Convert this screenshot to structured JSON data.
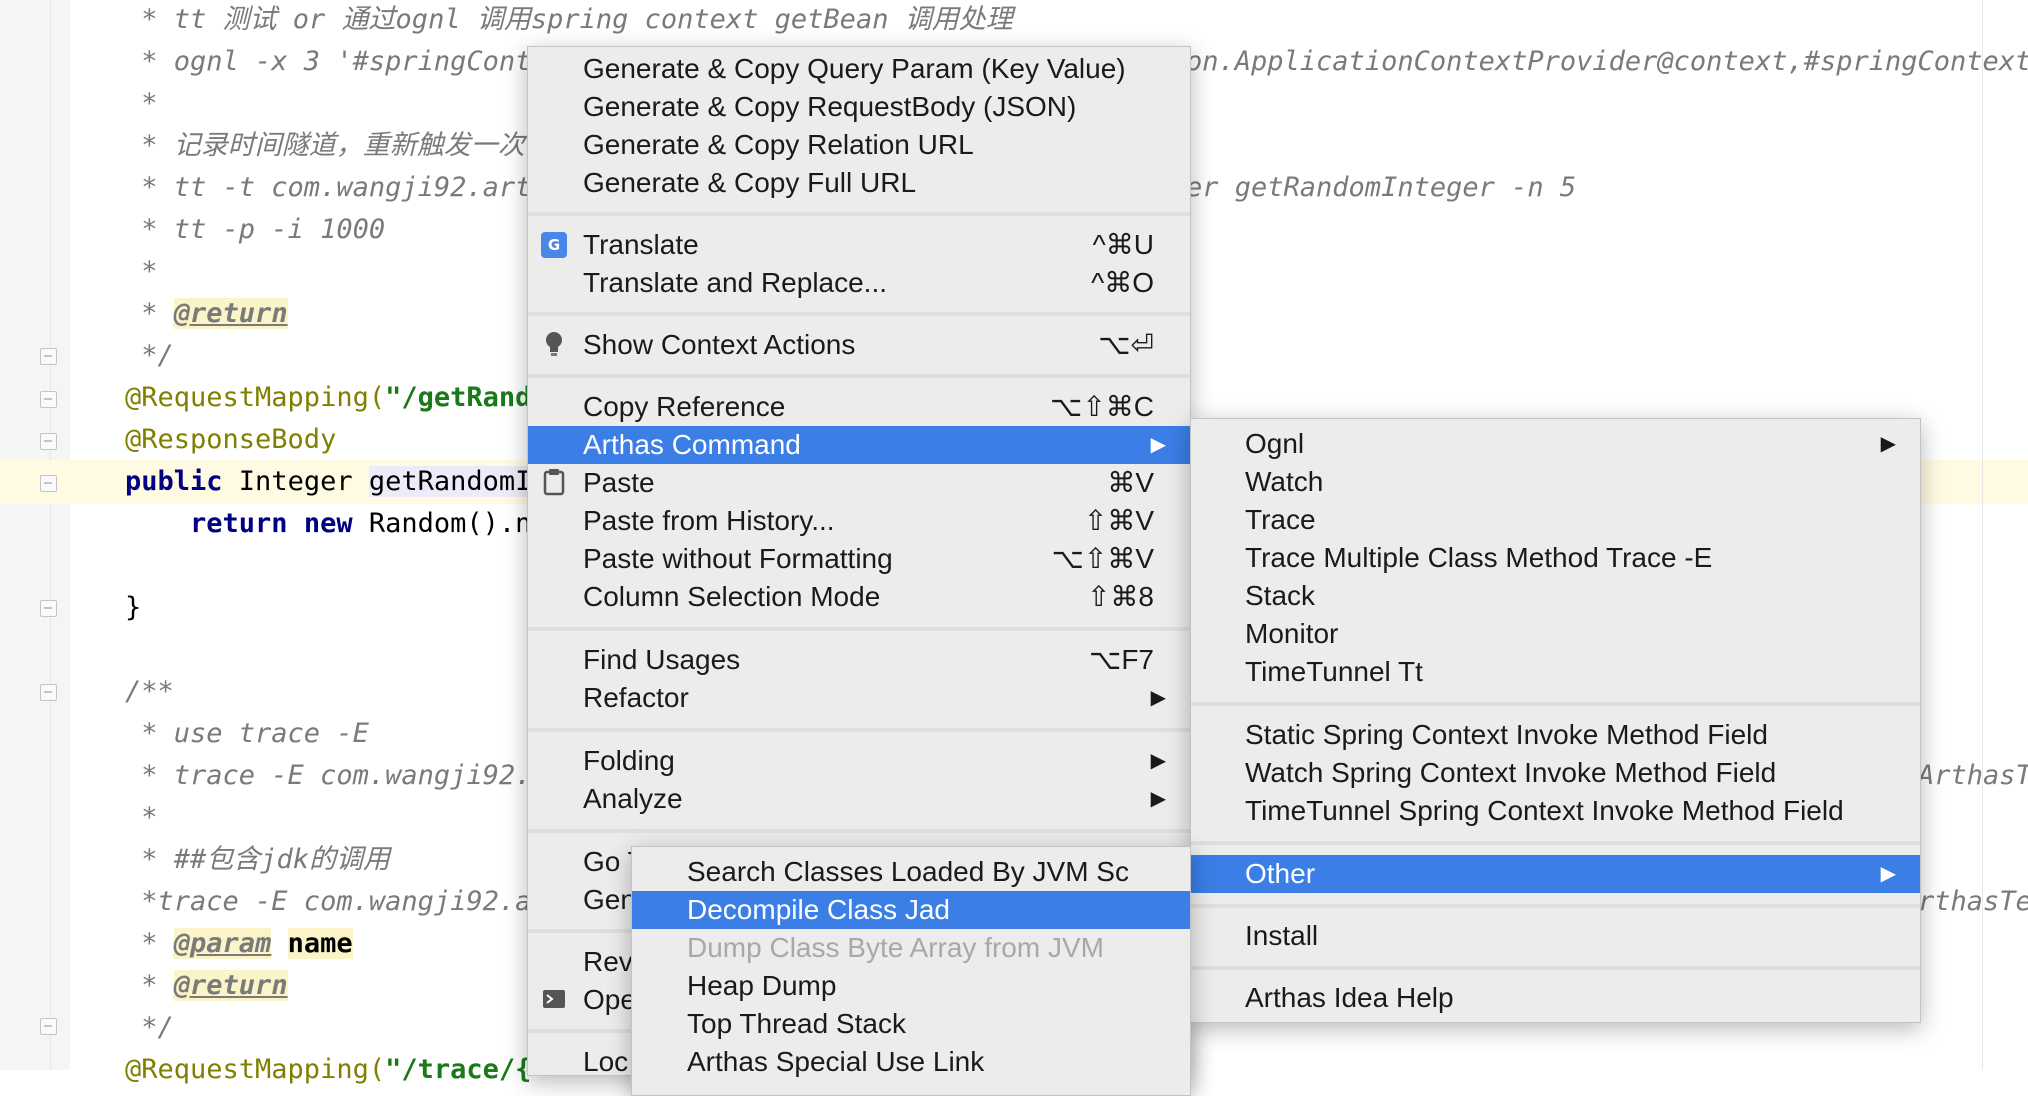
{
  "editor": {
    "code_lines": [
      {
        "t": " * tt 测试 or 通过ognl 调用spring context getBean 调用处理"
      },
      {
        "t": " * ognl -x 3 '#springCont"
      },
      {
        "t": " *"
      },
      {
        "t": " * 记录时间隧道，重新触发一次"
      },
      {
        "t": " * tt -t com.wangji92.art"
      },
      {
        "t": " * tt -p -i 1000"
      },
      {
        "t": " *"
      },
      {
        "t": " * "
      },
      {
        "t": " */"
      },
      {
        "t": "@RequestMapping("
      },
      {
        "t": "@ResponseBody"
      },
      {
        "t": "public"
      },
      {
        "t": "return"
      },
      {
        "t": "}"
      },
      {
        "t": "/**"
      },
      {
        "t": " * use trace -E"
      },
      {
        "t": " * trace -E com.wangji92."
      },
      {
        "t": " *"
      },
      {
        "t": " * ##包含jdk的调用"
      },
      {
        "t": " *trace -E com.wangji92.a"
      },
      {
        "t": " * "
      },
      {
        "t": " * "
      },
      {
        "t": " */"
      },
      {
        "t": "@RequestMapping("
      }
    ],
    "snippets": {
      "return_tag": "@return",
      "param_tag": "@param",
      "param_name": "name",
      "get_rand_str": "\"/getRand",
      "integer": " Integer ",
      "get_random": "getRandomI",
      "new_kw": "new",
      "random_call": " Random().n",
      "trace_str": "\"/trace/{",
      "right_ognl": "on.ApplicationContextProvider@context,#springContext.",
      "right_tt": "er getRandomInteger -n 5",
      "right_arthas_1": "ArthasT",
      "right_arthas_2": "rthasTe"
    }
  },
  "main_menu": {
    "items": [
      {
        "label": "Generate & Copy Query Param (Key Value)"
      },
      {
        "label": "Generate & Copy RequestBody (JSON)"
      },
      {
        "label": "Generate & Copy Relation URL"
      },
      {
        "label": "Generate & Copy Full URL"
      },
      {
        "label": "Translate",
        "shortcut": "^⌘U"
      },
      {
        "label": "Translate and Replace...",
        "shortcut": "^⌘O"
      },
      {
        "label": "Show Context Actions",
        "shortcut": "⌥⏎"
      },
      {
        "label": "Copy Reference",
        "shortcut": "⌥⇧⌘C"
      },
      {
        "label": "Arthas Command"
      },
      {
        "label": "Paste",
        "shortcut": "⌘V"
      },
      {
        "label": "Paste from History...",
        "shortcut": "⇧⌘V"
      },
      {
        "label": "Paste without Formatting",
        "shortcut": "⌥⇧⌘V"
      },
      {
        "label": "Column Selection Mode",
        "shortcut": "⇧⌘8"
      },
      {
        "label": "Find Usages",
        "shortcut": "⌥F7"
      },
      {
        "label": "Refactor"
      },
      {
        "label": "Folding"
      },
      {
        "label": "Analyze"
      },
      {
        "label": "Go T"
      },
      {
        "label": "Gen"
      },
      {
        "label": "Rev"
      },
      {
        "label": "Ope"
      },
      {
        "label": "Loc"
      }
    ],
    "translate_icon_text": "G"
  },
  "arthas_menu": {
    "items": [
      {
        "label": "Ognl"
      },
      {
        "label": "Watch"
      },
      {
        "label": "Trace"
      },
      {
        "label": "Trace Multiple Class Method Trace -E"
      },
      {
        "label": "Stack"
      },
      {
        "label": "Monitor"
      },
      {
        "label": "TimeTunnel Tt"
      },
      {
        "label": "Static Spring Context Invoke  Method Field"
      },
      {
        "label": "Watch Spring Context Invoke Method Field"
      },
      {
        "label": "TimeTunnel Spring Context Invoke Method Field"
      },
      {
        "label": "Other"
      },
      {
        "label": "Install"
      },
      {
        "label": "Arthas Idea Help"
      }
    ]
  },
  "other_menu": {
    "items": [
      {
        "label": "Search Classes Loaded By JVM Sc"
      },
      {
        "label": "Decompile Class Jad"
      },
      {
        "label": "Dump Class Byte Array from JVM"
      },
      {
        "label": "Heap Dump"
      },
      {
        "label": "Top Thread Stack"
      },
      {
        "label": "Arthas Special Use Link"
      }
    ]
  },
  "icons": {
    "submenu_arrow": "▶"
  },
  "colors": {
    "selection": "#3a7ee6",
    "menu_bg": "#ececec",
    "comment": "#7a7a7a",
    "annotation": "#808000",
    "string": "#1a7a1a",
    "keyword": "#000080"
  }
}
